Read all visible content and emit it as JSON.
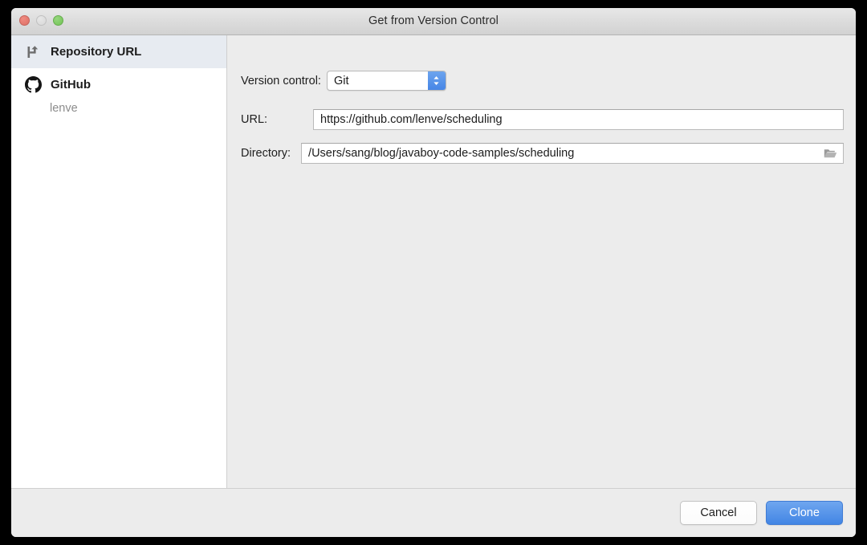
{
  "window": {
    "title": "Get from Version Control",
    "traffic_lights": [
      {
        "name": "close",
        "color": "#e07a70"
      },
      {
        "name": "minimize",
        "color": "#dcdcdc"
      },
      {
        "name": "zoom",
        "color": "#7cc85c"
      }
    ]
  },
  "sidebar": {
    "items": [
      {
        "label": "Repository URL",
        "icon": "branch-icon",
        "selected": true
      },
      {
        "label": "GitHub",
        "icon": "github-icon",
        "selected": false,
        "account": "lenve"
      }
    ]
  },
  "form": {
    "version_control": {
      "label": "Version control:",
      "value": "Git",
      "options": [
        "Git"
      ]
    },
    "url": {
      "label": "URL:",
      "value": "https://github.com/lenve/scheduling",
      "placeholder": ""
    },
    "directory": {
      "label": "Directory:",
      "value": "/Users/sang/blog/javaboy-code-samples/scheduling",
      "placeholder": "",
      "browse_icon": "folder-open-icon"
    }
  },
  "footer": {
    "cancel_label": "Cancel",
    "clone_label": "Clone"
  },
  "colors": {
    "accent": "#4285e4",
    "panel_bg": "#ececec",
    "sidebar_bg": "#ffffff",
    "sidebar_selected": "#e7ebf1"
  }
}
